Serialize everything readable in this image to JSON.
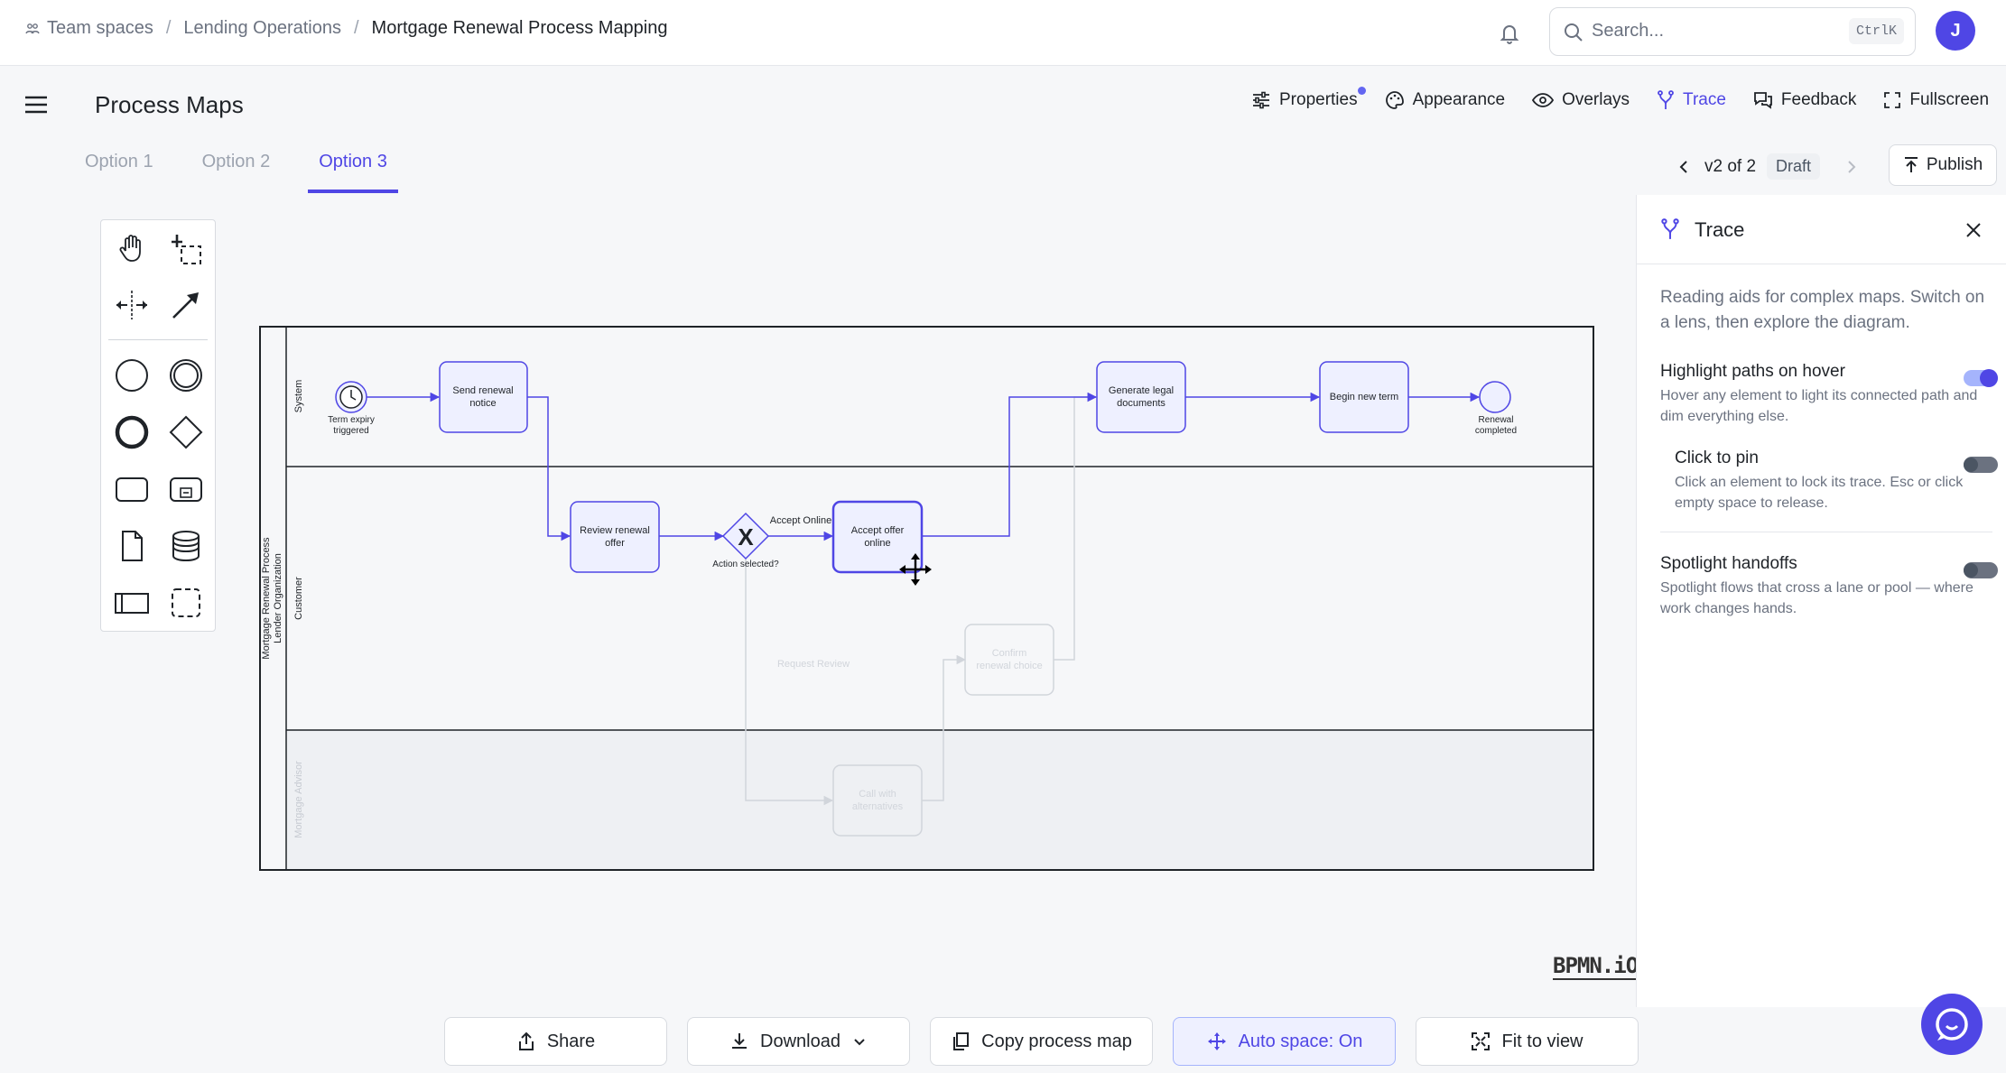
{
  "breadcrumb": {
    "items": [
      "Team spaces",
      "Lending Operations",
      "Mortgage Renewal Process Mapping"
    ]
  },
  "search": {
    "placeholder": "Search...",
    "shortcut": "CtrlK"
  },
  "user": {
    "avatar_initial": "J"
  },
  "page": {
    "title": "Process Maps"
  },
  "toolbar": {
    "properties": "Properties",
    "appearance": "Appearance",
    "overlays": "Overlays",
    "trace": "Trace",
    "feedback": "Feedback",
    "fullscreen": "Fullscreen"
  },
  "tabs": [
    {
      "label": "Option 1"
    },
    {
      "label": "Option 2"
    },
    {
      "label": "Option 3"
    }
  ],
  "version": {
    "label": "v2 of 2",
    "status": "Draft",
    "publish": "Publish"
  },
  "diagram": {
    "pool": "Mortgage Renewal Process",
    "pool_sub": "Lender Organization",
    "lanes": {
      "system": "System",
      "customer": "Customer",
      "advisor": "Mortgage Advisor"
    },
    "events": {
      "start": "Term expiry triggered",
      "end": "Renewal completed"
    },
    "tasks": {
      "send": [
        "Send renewal",
        "notice"
      ],
      "review": [
        "Review renewal",
        "offer"
      ],
      "accept": [
        "Accept offer",
        "online"
      ],
      "generate": [
        "Generate legal",
        "documents"
      ],
      "begin": [
        "Begin new term"
      ],
      "confirm": [
        "Confirm",
        "renewal choice"
      ],
      "call": [
        "Call with",
        "alternatives"
      ]
    },
    "gateway": {
      "label": "Action selected?",
      "symbol": "X"
    },
    "flows": {
      "accept_online": "Accept Online",
      "request_review": "Request Review"
    },
    "logo": "BPMN.iO"
  },
  "trace_panel": {
    "title": "Trace",
    "description": "Reading aids for complex maps. Switch on a lens, then explore the diagram.",
    "options": {
      "highlight": {
        "title": "Highlight paths on hover",
        "desc": "Hover any element to light its connected path and dim everything else.",
        "on": true
      },
      "pin": {
        "title": "Click to pin",
        "desc": "Click an element to lock its trace. Esc or click empty space to release.",
        "on": false
      },
      "spotlight": {
        "title": "Spotlight handoffs",
        "desc": "Spotlight flows that cross a lane or pool — where work changes hands.",
        "on": false
      }
    }
  },
  "bottom": {
    "share": "Share",
    "download": "Download",
    "copy": "Copy process map",
    "auto": "Auto space: On",
    "fit": "Fit to view"
  },
  "colors": {
    "accent": "#4f46e5",
    "task_fill": "#eef0ff",
    "dim": "#d1d5db"
  }
}
